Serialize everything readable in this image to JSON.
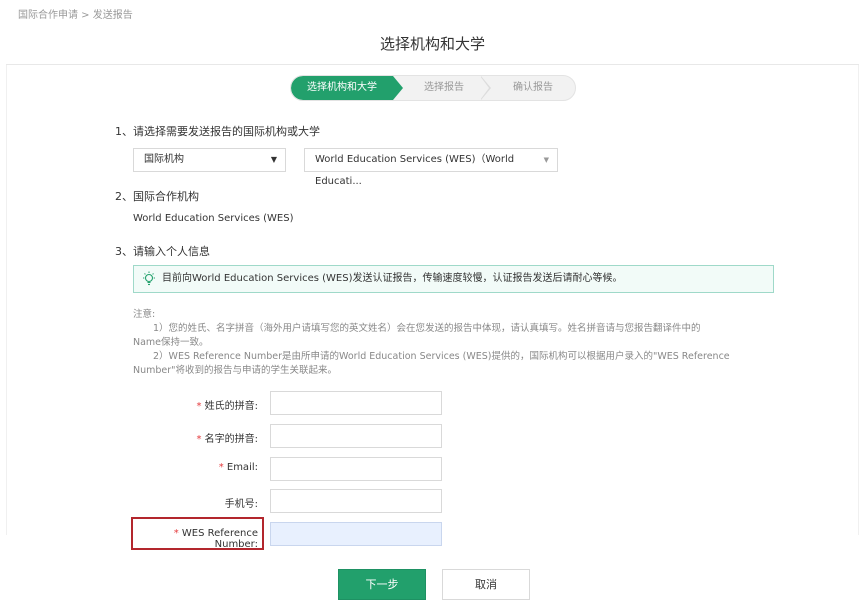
{
  "breadcrumb": "国际合作申请 > 发送报告",
  "page_title": "选择机构和大学",
  "steps": [
    "选择机构和大学",
    "选择报告",
    "确认报告"
  ],
  "sections": {
    "s1": "1、请选择需要发送报告的国际机构或大学",
    "s2": "2、国际合作机构",
    "s3": "3、请输入个人信息"
  },
  "select_type": {
    "value": "国际机构",
    "arrow": "▼"
  },
  "select_org": {
    "value": "World Education Services (WES)（World Educati...",
    "arrow": "▼"
  },
  "org_name": "World Education Services (WES)",
  "notice": "目前向World Education Services (WES)发送认证报告，传输速度较慢，认证报告发送后请耐心等候。",
  "notes": {
    "title": "注意:",
    "n1a": "1）您的姓氏、名字拼音（海外用户请填写您的英文姓名）会在您发送的报告中体现，请认真填写。姓名拼音请与您报告翻译件中的",
    "n1b": "Name保持一致。",
    "n2a": "2）WES Reference Number是由所申请的World Education Services (WES)提供的，国际机构可以根据用户录入的\"WES Reference",
    "n2b": "Number\"将收到的报告与申请的学生关联起来。"
  },
  "form": {
    "star": "*",
    "surname": "姓氏的拼音:",
    "given": "名字的拼音:",
    "email": "Email:",
    "phone": "手机号:",
    "wes": "WES Reference Number:"
  },
  "buttons": {
    "next": "下一步",
    "cancel": "取消"
  },
  "colors": {
    "accent": "#22a06c",
    "highlight_border": "#b3262d",
    "required": "#e4393c"
  }
}
